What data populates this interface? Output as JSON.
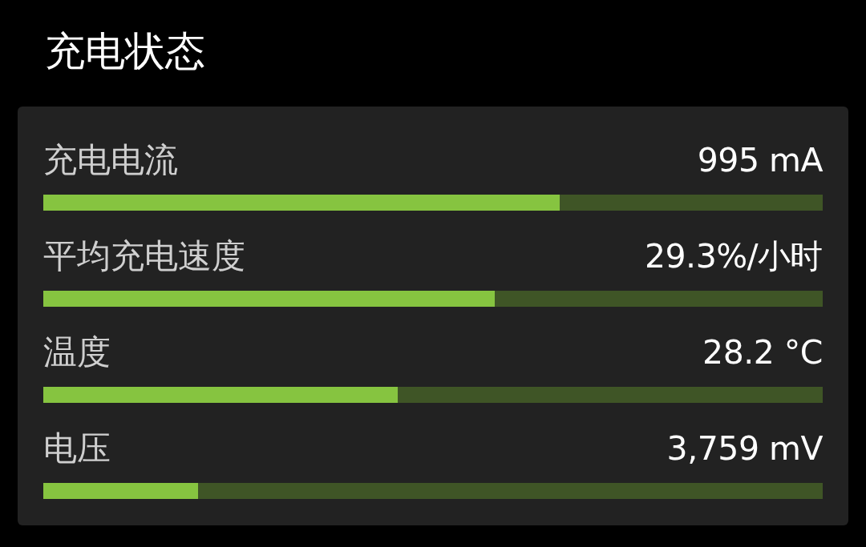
{
  "title": "充电状态",
  "metrics": [
    {
      "label": "充电电流",
      "value": "995 mA",
      "level": 0.663
    },
    {
      "label": "平均充电速度",
      "value": "29.3%/小时",
      "level": 0.579
    },
    {
      "label": "温度",
      "value": "28.2 °C",
      "level": 0.455
    },
    {
      "label": "电压",
      "value": "3,759 mV",
      "level": 0.199
    }
  ]
}
